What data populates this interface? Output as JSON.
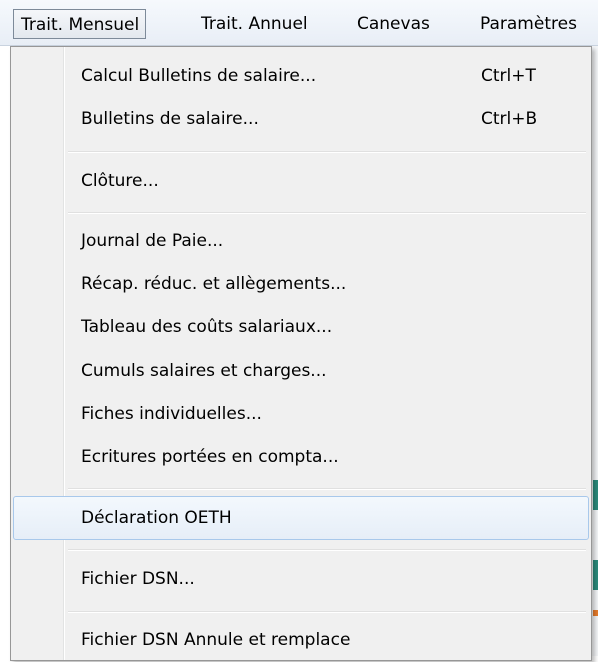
{
  "menubar": {
    "items": [
      {
        "label": "Trait. Mensuel",
        "active": true
      },
      {
        "label": "Trait. Annuel"
      },
      {
        "label": "Canevas"
      },
      {
        "label": "Paramètres"
      }
    ]
  },
  "menu": {
    "items": [
      {
        "label": "Calcul Bulletins de salaire...",
        "shortcut": "Ctrl+T"
      },
      {
        "label": "Bulletins de salaire...",
        "shortcut": "Ctrl+B"
      },
      {
        "label": "Clôture..."
      },
      {
        "label": "Journal de Paie..."
      },
      {
        "label": "Récap. réduc. et allègements..."
      },
      {
        "label": "Tableau des coûts salariaux..."
      },
      {
        "label": "Cumuls salaires et charges..."
      },
      {
        "label": "Fiches individuelles..."
      },
      {
        "label": "Ecritures portées en compta..."
      },
      {
        "label": "Déclaration OETH",
        "highlighted": true
      },
      {
        "label": "Fichier DSN..."
      },
      {
        "label": "Fichier DSN Annule et remplace"
      }
    ]
  },
  "colors": {
    "highlight_border": "#a8c8eb",
    "menu_background": "#f0f0f0"
  }
}
